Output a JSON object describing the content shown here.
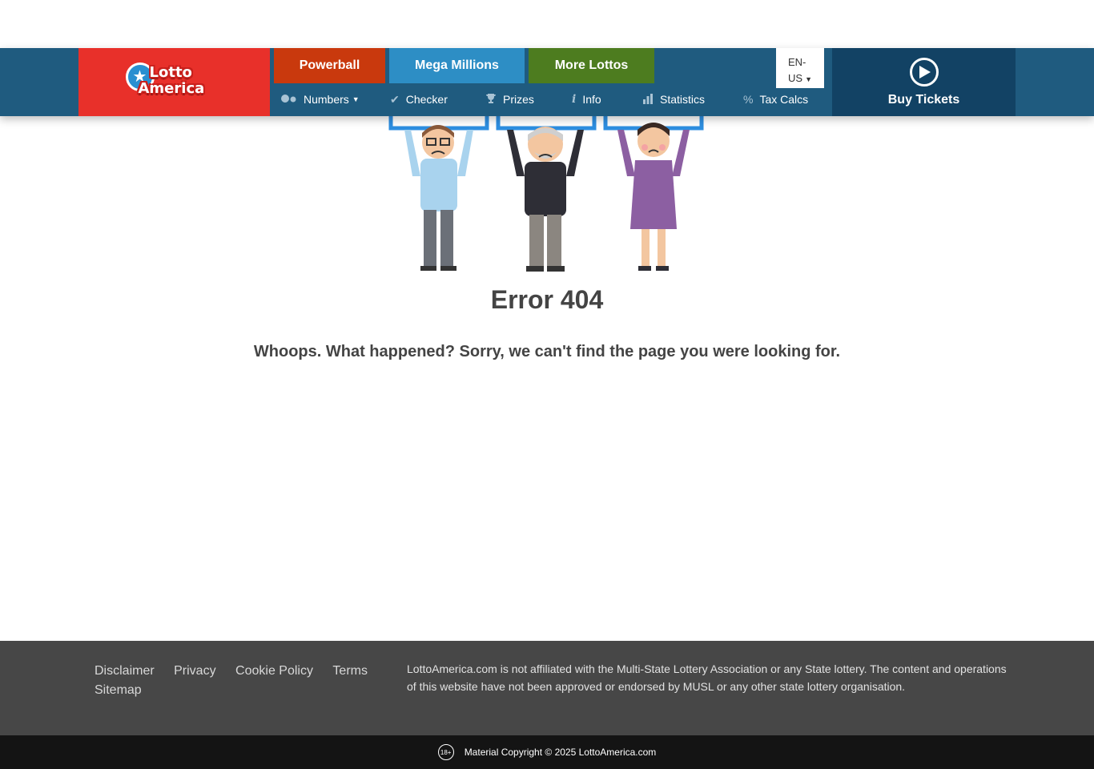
{
  "brand": {
    "logo_line1": "Lotto",
    "logo_line2": "America"
  },
  "games": {
    "powerball": "Powerball",
    "mega_millions": "Mega Millions",
    "more_lottos": "More Lottos"
  },
  "language": {
    "line1": "EN-",
    "line2": "US"
  },
  "subnav": {
    "numbers": "Numbers",
    "checker": "Checker",
    "prizes": "Prizes",
    "info": "Info",
    "statistics": "Statistics",
    "tax_calcs": "Tax Calcs"
  },
  "buy": {
    "label": "Buy Tickets"
  },
  "error": {
    "title": "Error 404",
    "message": "Whoops. What happened? Sorry, we can't find the page you were looking for."
  },
  "footer": {
    "links": {
      "disclaimer": "Disclaimer",
      "privacy": "Privacy",
      "cookie_policy": "Cookie Policy",
      "terms": "Terms",
      "sitemap": "Sitemap"
    },
    "disclaimer_text": "LottoAmerica.com is not affiliated with the Multi-State Lottery Association or any State lottery. The content and operations of this website have not been approved or endorsed by MUSL or any other state lottery organisation.",
    "age_badge": "18+",
    "copyright": "Material Copyright © 2025 LottoAmerica.com"
  },
  "colors": {
    "navbar": "#1f5b7f",
    "logo_bg": "#e8302a",
    "powerball": "#c9390d",
    "mega_millions": "#2d8ec5",
    "more_lottos": "#4d7c1f",
    "buy_tickets": "#124264",
    "footer": "#474747",
    "bottom_bar": "#141414"
  }
}
